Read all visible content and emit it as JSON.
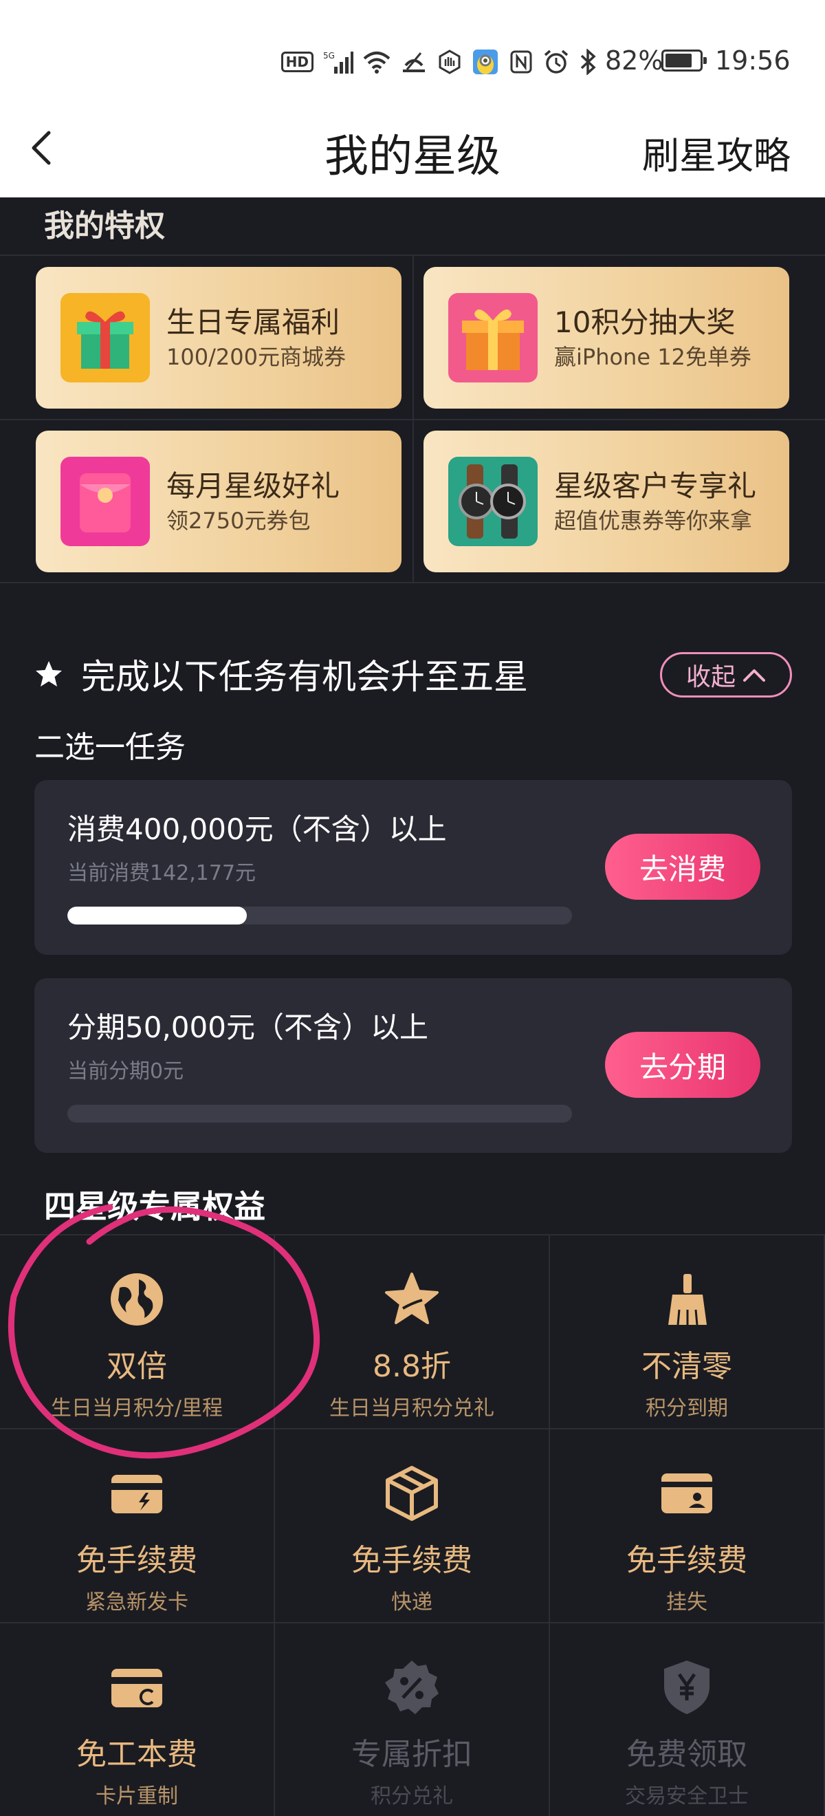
{
  "status_bar": {
    "hd": "HD",
    "network": "5G",
    "battery_pct": "82%",
    "time": "19:56",
    "icons": [
      "hd-icon",
      "signal-icon",
      "wifi-icon",
      "hotspot-icon",
      "hand-icon",
      "minion-app-icon",
      "nfc-icon",
      "alarm-icon",
      "bluetooth-icon",
      "battery-icon"
    ]
  },
  "header": {
    "title": "我的星级",
    "right_link": "刷星攻略"
  },
  "privileges": {
    "title": "我的特权",
    "items": [
      {
        "name": "生日专属福利",
        "sub": "100/200元商城券",
        "icon": "gift-box-icon"
      },
      {
        "name": "10积分抽大奖",
        "sub": "赢iPhone 12免单券",
        "icon": "prize-gift-icon"
      },
      {
        "name": "每月星级好礼",
        "sub": "领2750元券包",
        "icon": "red-packet-icon"
      },
      {
        "name": "星级客户专享礼",
        "sub": "超值优惠券等你来拿",
        "icon": "smartwatch-icon"
      }
    ]
  },
  "tasks": {
    "title": "完成以下任务有机会升至五星",
    "collapse_label": "收起",
    "choose_title": "二选一任务",
    "items": [
      {
        "name": "消费400,000元（不含）以上",
        "progress_text": "当前消费142,177元",
        "button": "去消费",
        "progress": 0.355
      },
      {
        "name": "分期50,000元（不含）以上",
        "progress_text": "当前分期0元",
        "button": "去分期",
        "progress": 0
      }
    ]
  },
  "benefits": {
    "title": "四星级专属权益",
    "items": [
      {
        "name": "双倍",
        "sub": "生日当月积分/里程",
        "icon": "globe-icon"
      },
      {
        "name": "8.8折",
        "sub": "生日当月积分兑礼",
        "icon": "star-icon"
      },
      {
        "name": "不清零",
        "sub": "积分到期",
        "icon": "broom-icon"
      },
      {
        "name": "免手续费",
        "sub": "紧急新发卡",
        "icon": "card-lightning-icon"
      },
      {
        "name": "免手续费",
        "sub": "快递",
        "icon": "package-icon"
      },
      {
        "name": "免手续费",
        "sub": "挂失",
        "icon": "card-user-icon"
      },
      {
        "name": "免工本费",
        "sub": "卡片重制",
        "icon": "card-refresh-icon"
      },
      {
        "name": "专属折扣",
        "sub": "积分兑礼",
        "icon": "discount-badge-icon"
      },
      {
        "name": "免费领取",
        "sub": "交易安全卫士",
        "icon": "shield-yuan-icon"
      }
    ]
  },
  "colors": {
    "background": "#1b1c22",
    "card": "#2a2b35",
    "gold": "#e8b980",
    "accent_pink": "#ee4479",
    "annotation": "#e0307a"
  }
}
